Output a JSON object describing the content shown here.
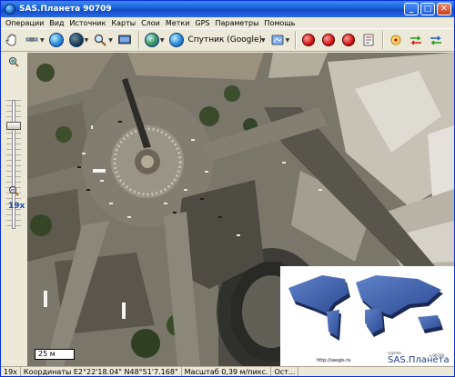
{
  "window": {
    "title": "SAS.Планета 90709",
    "minimize": "_",
    "maximize": "□",
    "close": "✕"
  },
  "menu": [
    "Операции",
    "Вид",
    "Источник",
    "Карты",
    "Слои",
    "Метки",
    "GPS",
    "Параметры",
    "Помощь"
  ],
  "toolbar": {
    "map_source_label": "Спутник (Google)",
    "icons": [
      "hand-icon",
      "satellite-icon",
      "globe-icon",
      "dark-globe-icon",
      "zoom-icon",
      "screen-icon",
      "world-icon",
      "layers-icon",
      "marker-icon",
      "marker-add-icon",
      "marker-delete-icon",
      "edit-icon",
      "gps-icon",
      "route-icon",
      "track-icon"
    ]
  },
  "left_panel": {
    "zoom_level": "19x",
    "zoom_fraction": 0.82
  },
  "map": {
    "scale_label": "25 м"
  },
  "logo": {
    "url": "http://sasgis.ru",
    "subtitle": "группа",
    "name": "SAS.Планета",
    "version": "v.90709"
  },
  "status": {
    "zoom": "19x",
    "coordinates": "Координаты E2°22'18.04\" N48°51'7.168\"",
    "scale": "Масштаб 0,39 м/пикс.",
    "remaining": "Ост..."
  }
}
